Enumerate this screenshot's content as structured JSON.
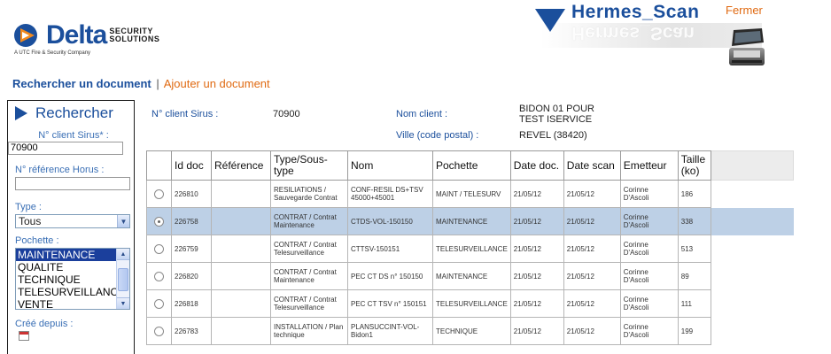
{
  "app": {
    "name": "Hermes_Scan",
    "close_label": "Fermer",
    "logo": {
      "word": "Delta",
      "security": "SECURITY",
      "solutions": "SOLUTIONS",
      "tagline": "A UTC Fire & Security Company"
    }
  },
  "nav": {
    "active": "Rechercher un document",
    "separator": "|",
    "link": "Ajouter un document"
  },
  "search_panel": {
    "title": "Rechercher",
    "client_sirus_label": "N° client Sirus* :",
    "client_sirus_value": "70900",
    "horus_label": "N° référence Horus :",
    "horus_value": "",
    "type_label": "Type :",
    "type_value": "Tous",
    "pochette_label": "Pochette :",
    "pochette_options": [
      "MAINTENANCE",
      "QUALITE",
      "TECHNIQUE",
      "TELESURVEILLANCE",
      "VENTE"
    ],
    "pochette_selected_index": 0,
    "cree_depuis_label": "Créé depuis :"
  },
  "client_info": {
    "sirus_label": "N° client Sirus :",
    "sirus_value": "70900",
    "name_label": "Nom client :",
    "name_value_line1": "BIDON 01 POUR",
    "name_value_line2": "TEST ISERVICE",
    "city_label": "Ville (code postal) :",
    "city_value": "REVEL (38420)"
  },
  "table": {
    "headers": {
      "id": "Id doc",
      "ref": "Référence",
      "type": "Type/Sous-type",
      "nom": "Nom",
      "pochette": "Pochette",
      "date_doc": "Date doc.",
      "date_scan": "Date scan",
      "emetteur": "Emetteur",
      "taille": "Taille (ko)"
    },
    "rows": [
      {
        "id": "226810",
        "ref": "",
        "type": "RESILIATIONS / Sauvegarde Contrat",
        "nom": "CONF-RESIL DS+TSV 45000+45001",
        "pochette": "MAINT / TELESURV",
        "date_doc": "21/05/12",
        "date_scan": "21/05/12",
        "emetteur": "Corinne D'Ascoli",
        "taille": "186",
        "selected": false
      },
      {
        "id": "226758",
        "ref": "",
        "type": "CONTRAT / Contrat Maintenance",
        "nom": "CTDS-VOL-150150",
        "pochette": "MAINTENANCE",
        "date_doc": "21/05/12",
        "date_scan": "21/05/12",
        "emetteur": "Corinne D'Ascoli",
        "taille": "338",
        "selected": true
      },
      {
        "id": "226759",
        "ref": "",
        "type": "CONTRAT / Contrat Telesurveillance",
        "nom": "CTTSV-150151",
        "pochette": "TELESURVEILLANCE",
        "date_doc": "21/05/12",
        "date_scan": "21/05/12",
        "emetteur": "Corinne D'Ascoli",
        "taille": "513",
        "selected": false
      },
      {
        "id": "226820",
        "ref": "",
        "type": "CONTRAT / Contrat Maintenance",
        "nom": "PEC CT DS n° 150150",
        "pochette": "MAINTENANCE",
        "date_doc": "21/05/12",
        "date_scan": "21/05/12",
        "emetteur": "Corinne D'Ascoli",
        "taille": "89",
        "selected": false
      },
      {
        "id": "226818",
        "ref": "",
        "type": "CONTRAT / Contrat Telesurveillance",
        "nom": "PEC CT TSV n° 150151",
        "pochette": "TELESURVEILLANCE",
        "date_doc": "21/05/12",
        "date_scan": "21/05/12",
        "emetteur": "Corinne D'Ascoli",
        "taille": "111",
        "selected": false
      },
      {
        "id": "226783",
        "ref": "",
        "type": "INSTALLATION / Plan technique",
        "nom": "PLANSUCCINT-VOL-Bidon1",
        "pochette": "TECHNIQUE",
        "date_doc": "21/05/12",
        "date_scan": "21/05/12",
        "emetteur": "Corinne D'Ascoli",
        "taille": "199",
        "selected": false
      }
    ]
  },
  "colors": {
    "brand_blue": "#1b4f9c",
    "accent_orange": "#e06a12",
    "selected_row": "#bdd0e6",
    "listbox_selected": "#1b3f9c"
  },
  "icons": {
    "hermes": "down-triangle-icon",
    "scanner": "scanner-icon",
    "panel": "right-triangle-icon",
    "calendar": "calendar-icon"
  }
}
